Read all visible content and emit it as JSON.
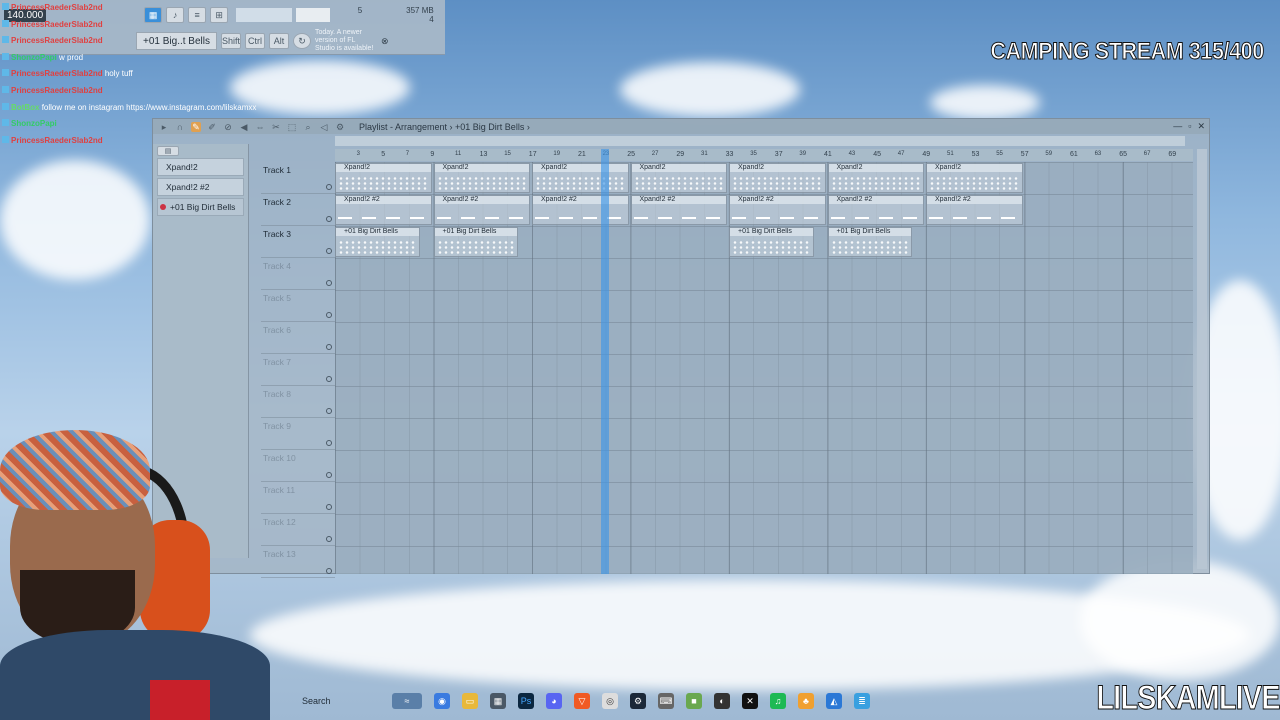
{
  "overlay": {
    "stream_title": "CAMPING STREAM 315/400",
    "brand": "LILSKAMLIVE"
  },
  "fl_toolbar": {
    "tempo": "140.000",
    "pattern": "+01 Big..t Bells",
    "btn_shift": "Shift",
    "btn_ctrl": "Ctrl",
    "btn_alt": "Alt",
    "update_hint": "Today. A newer version of FL Studio is available!",
    "mem_top": "5",
    "mem_mb": "357 MB",
    "mem_bottom": "4"
  },
  "chat": [
    {
      "name": "PrincessRaederSlab2nd",
      "msg": "",
      "color": "#e04040"
    },
    {
      "name": "PrincessRaederSlab2nd",
      "msg": "",
      "color": "#e04040"
    },
    {
      "name": "PrincessRaederSlab2nd",
      "msg": "",
      "color": "#e04040"
    },
    {
      "name": "ShonzoPapi",
      "msg": "w prod",
      "color": "#33cc66"
    },
    {
      "name": "PrincessRaederSlab2nd",
      "msg": "holy tuff",
      "color": "#e04040"
    },
    {
      "name": "PrincessRaederSlab2nd",
      "msg": "",
      "color": "#e04040"
    },
    {
      "name": "BotBox",
      "msg": "follow me on instagram https://www.instagram.com/lilskamxx",
      "color": "#66dd66"
    },
    {
      "name": "ShonzoPapi",
      "msg": "",
      "color": "#33cc66"
    },
    {
      "name": "PrincessRaederSlab2nd",
      "msg": "",
      "color": "#e04040"
    }
  ],
  "playlist": {
    "title": "Playlist - Arrangement › +01 Big Dirt Bells ›",
    "picker": [
      {
        "label": "Xpand!2",
        "selected": false
      },
      {
        "label": "Xpand!2 #2",
        "selected": false
      },
      {
        "label": "+01 Big Dirt Bells",
        "selected": true
      }
    ],
    "tracks": [
      "Track 1",
      "Track 2",
      "Track 3",
      "Track 4",
      "Track 5",
      "Track 6",
      "Track 7",
      "Track 8",
      "Track 9",
      "Track 10",
      "Track 11",
      "Track 12",
      "Track 13"
    ],
    "timeline": [
      "3",
      "5",
      "7",
      "9",
      "11",
      "13",
      "15",
      "17",
      "19",
      "21",
      "23",
      "25",
      "27",
      "29",
      "31",
      "33",
      "35",
      "37",
      "39",
      "41",
      "43",
      "45",
      "47",
      "49",
      "51",
      "53",
      "55",
      "57",
      "59",
      "61",
      "63",
      "65",
      "67",
      "69"
    ],
    "clip_xpand": "Xpand!2",
    "clip_xpand2": "Xpand!2 #2",
    "clip_bells": "+01 Big Dirt Bells"
  },
  "taskbar": {
    "search": "Search"
  }
}
